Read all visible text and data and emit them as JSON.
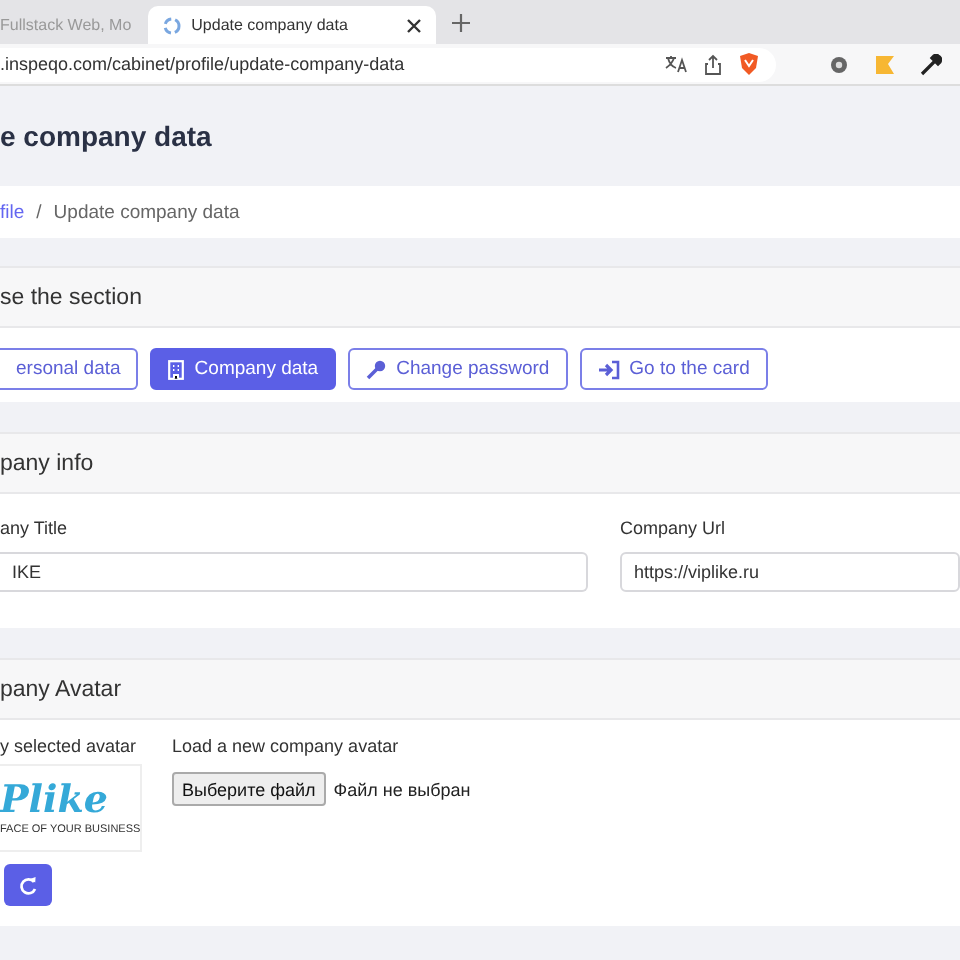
{
  "browser": {
    "tabs": [
      {
        "title": "Fullstack Web, Mo",
        "selected": false
      },
      {
        "title": "Update company data",
        "selected": true
      }
    ],
    "url": ".inspeqo.com/cabinet/profile/update-company-data"
  },
  "page_title": "e company data",
  "breadcrumb": [
    {
      "label": "file",
      "link": true
    },
    {
      "label": "Update company data",
      "link": false
    }
  ],
  "breadcrumb_separator": "/",
  "section_card": {
    "title": "se the section",
    "buttons": [
      {
        "label": "ersonal data",
        "selected": false
      },
      {
        "label": "Company data",
        "selected": true
      },
      {
        "label": "Change password",
        "selected": false
      },
      {
        "label": "Go to the card",
        "selected": false
      }
    ]
  },
  "info_card": {
    "title": "pany info",
    "fields": [
      {
        "label": "any Title",
        "value": "IKE"
      },
      {
        "label": "Company Url",
        "value": "https://viplike.ru"
      }
    ]
  },
  "avatar_card": {
    "title": "pany Avatar",
    "current_label": "y selected avatar",
    "logo_text": "Plike",
    "logo_tagline": "FACE OF YOUR BUSINESS",
    "upload_label": "Load a new company avatar",
    "file_button": "Выберите файл",
    "file_status": "Файл не выбран"
  }
}
